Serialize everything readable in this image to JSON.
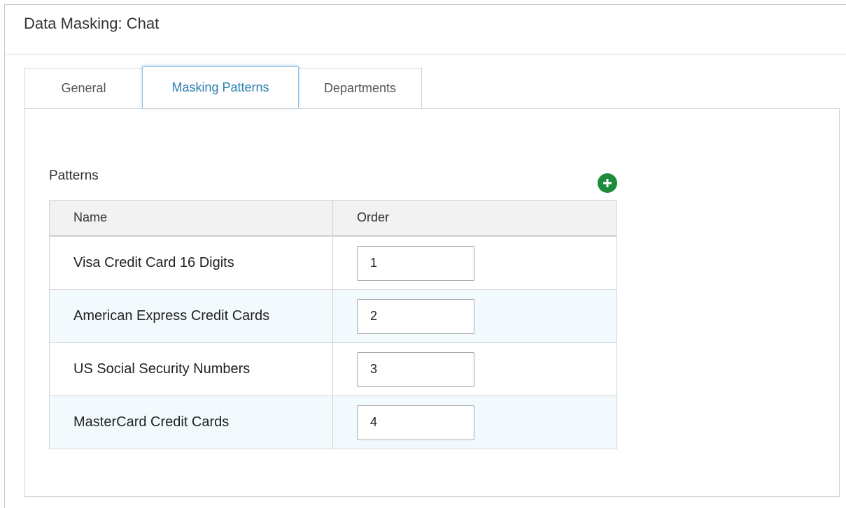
{
  "page": {
    "title": "Data Masking: Chat"
  },
  "tabs": [
    {
      "label": "General",
      "active": false
    },
    {
      "label": "Masking Patterns",
      "active": true
    },
    {
      "label": "Departments",
      "active": false
    }
  ],
  "patterns": {
    "section_label": "Patterns",
    "add_icon": "plus-circle-icon",
    "columns": [
      "Name",
      "Order"
    ],
    "rows": [
      {
        "name": "Visa Credit Card 16 Digits",
        "order": "1"
      },
      {
        "name": "American Express Credit Cards",
        "order": "2"
      },
      {
        "name": "US Social Security Numbers",
        "order": "3"
      },
      {
        "name": "MasterCard Credit Cards",
        "order": "4"
      }
    ]
  },
  "colors": {
    "active_tab": "#2a7fb0",
    "add_button": "#1e8a3c",
    "row_alt": "#f2fafd",
    "header_bg": "#f2f2f2"
  }
}
